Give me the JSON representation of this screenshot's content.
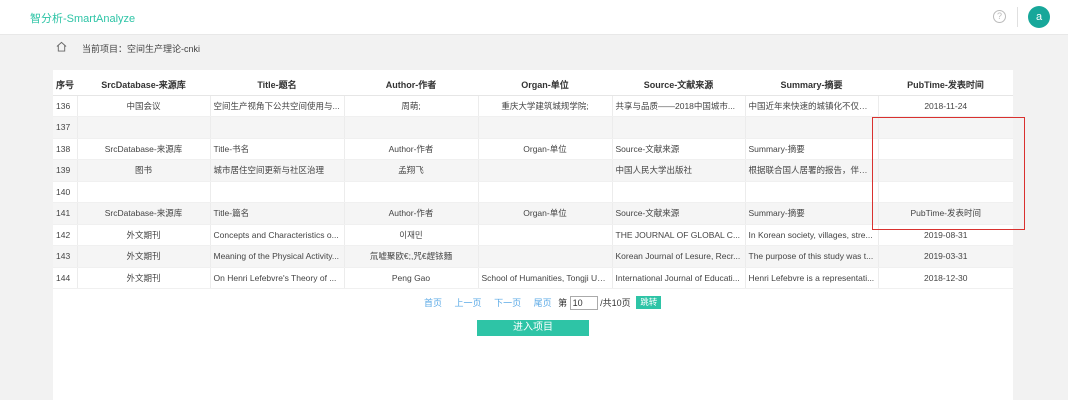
{
  "app": {
    "title": "智分析-SmartAnalyze",
    "help_icon": "question-circle-icon",
    "avatar_letter": "a"
  },
  "breadcrumb": {
    "icon": "home-icon",
    "label": "当前项目：空间生产理论-cnki"
  },
  "table": {
    "headers": [
      "序号",
      "SrcDatabase-来源库",
      "Title-题名",
      "Author-作者",
      "Organ-单位",
      "Source-文献来源",
      "Summary-摘要",
      "PubTime-发表时间"
    ],
    "rows": [
      [
        "136",
        "中国会议",
        "空间生产视角下公共空间使用与...",
        "周萌;",
        "重庆大学建筑城规学院;",
        "共享与品质——2018中国城市...",
        "中国近年来快速的城镇化不仅带...",
        "2018-11-24"
      ],
      [
        "137",
        "",
        "",
        "",
        "",
        "",
        "",
        ""
      ],
      [
        "138",
        "SrcDatabase-来源库",
        "Title-书名",
        "Author-作者",
        "Organ-单位",
        "Source-文献来源",
        "Summary-摘要",
        ""
      ],
      [
        "139",
        "图书",
        "城市居住空间更新与社区治理",
        "孟翔飞",
        "",
        "中国人民大学出版社",
        "根据联合国人居署的报告，伴随...",
        ""
      ],
      [
        "140",
        "",
        "",
        "",
        "",
        "",
        "",
        ""
      ],
      [
        "141",
        "SrcDatabase-来源库",
        "Title-篇名",
        "Author-作者",
        "Organ-单位",
        "Source-文献来源",
        "Summary-摘要",
        "PubTime-发表时间"
      ],
      [
        "142",
        "外文期刊",
        "Concepts and Characteristics o...",
        "이재민",
        "",
        "THE JOURNAL OF GLOBAL C...",
        "In Korean society, villages, stre...",
        "2019-08-31"
      ],
      [
        "143",
        "外文期刊",
        "Meaning of the Physical Activity...",
        "氚嘘聚欧€;,咒€趕铱麵",
        "",
        "Korean Journal of Lesure, Recr...",
        "The purpose of this study was t...",
        "2019-03-31"
      ],
      [
        "144",
        "外文期刊",
        "On Henri Lefebvre's Theory of ...",
        "Peng Gao",
        "School of Humanities, Tongji Un...",
        "International Journal of Educati...",
        "Henri Lefebvre is a representati...",
        "2018-12-30"
      ]
    ]
  },
  "pager": {
    "first": "首页",
    "prev": "上一页",
    "next": "下一页",
    "last": "尾页",
    "page_prefix": "第",
    "page_value": "10",
    "page_suffix": "/共10页",
    "jump": "跳转"
  },
  "actions": {
    "enter_project": "进入项目"
  },
  "colors": {
    "accent": "#2ec4a6",
    "link": "#5aa9e6",
    "highlight": "#d9312f"
  }
}
